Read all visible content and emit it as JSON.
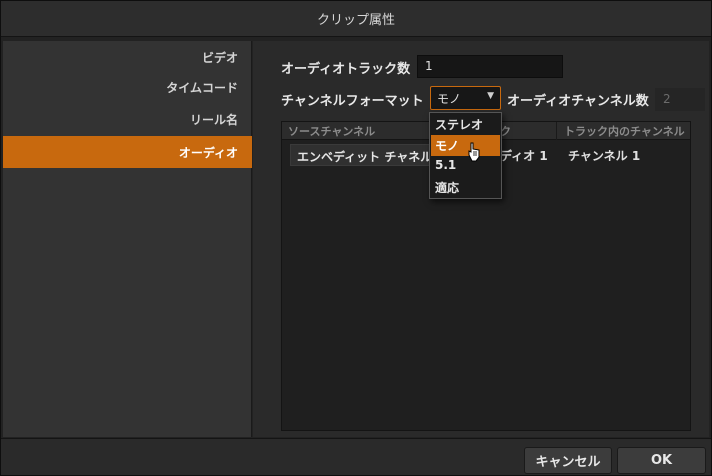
{
  "window": {
    "title": "クリップ属性"
  },
  "sidebar": {
    "items": [
      {
        "label": "ビデオ",
        "active": false
      },
      {
        "label": "タイムコード",
        "active": false
      },
      {
        "label": "リール名",
        "active": false
      },
      {
        "label": "オーディオ",
        "active": true
      }
    ]
  },
  "audio": {
    "track_count_label": "オーディオトラック数",
    "track_count_value": "1",
    "channel_format_label": "チャンネルフォーマット",
    "channel_format_value": "モノ",
    "channel_count_label": "オーディオチャンネル数",
    "channel_count_value": "2"
  },
  "table": {
    "headers": [
      "ソースチャンネル",
      "ク",
      "トラック内のチャンネル"
    ],
    "rows": [
      {
        "source": "エンベディット チャネル",
        "track": "ディオ 1",
        "channel": "チャンネル 1"
      }
    ]
  },
  "dropdown": {
    "options": [
      "ステレオ",
      "モノ",
      "5.1",
      "適応"
    ],
    "selected": "モノ"
  },
  "buttons": {
    "cancel": "キャンセル",
    "ok": "OK"
  },
  "colors": {
    "accent": "#c8690e"
  }
}
